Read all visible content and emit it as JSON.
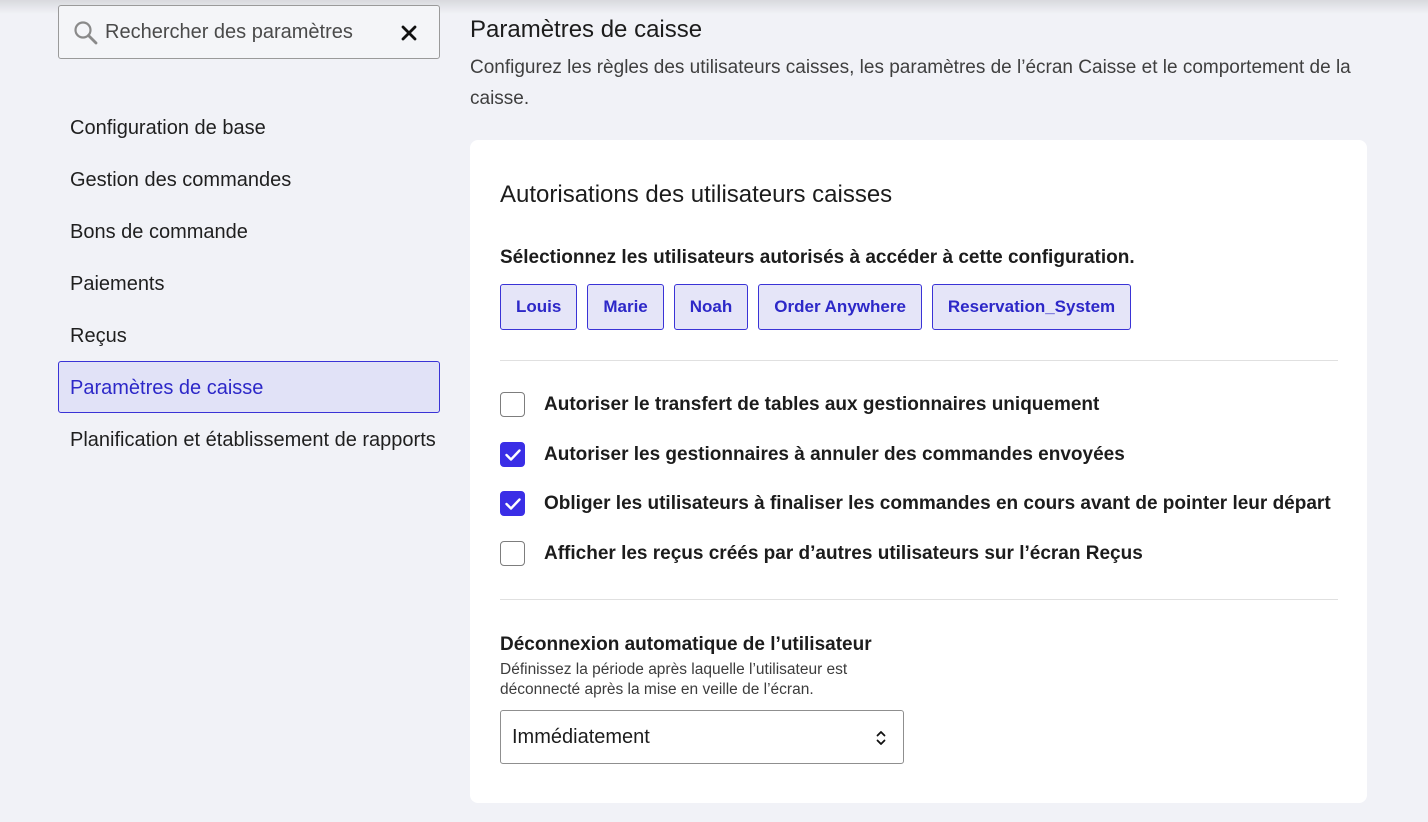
{
  "sidebar": {
    "search": {
      "placeholder": "Rechercher des paramètres",
      "value": ""
    },
    "items": [
      {
        "label": "Configuration de base",
        "active": false
      },
      {
        "label": "Gestion des commandes",
        "active": false
      },
      {
        "label": "Bons de commande",
        "active": false
      },
      {
        "label": "Paiements",
        "active": false
      },
      {
        "label": "Reçus",
        "active": false
      },
      {
        "label": "Paramètres de caisse",
        "active": true
      },
      {
        "label": "Planification et établissement de rapports",
        "active": false
      }
    ]
  },
  "main": {
    "title": "Paramètres de caisse",
    "description": "Configurez les règles des utilisateurs caisses, les paramètres de l’écran Caisse et le comportement de la caisse.",
    "card": {
      "title": "Autorisations des utilisateurs caisses",
      "users_label": "Sélectionnez les utilisateurs autorisés à accéder à cette configuration.",
      "users": [
        "Louis",
        "Marie",
        "Noah",
        "Order Anywhere",
        "Reservation_System"
      ],
      "options": [
        {
          "label": "Autoriser le transfert de tables aux gestionnaires uniquement",
          "checked": false
        },
        {
          "label": "Autoriser les gestionnaires à annuler des commandes envoyées",
          "checked": true
        },
        {
          "label": "Obliger les utilisateurs à finaliser les commandes en cours avant de pointer leur départ",
          "checked": true
        },
        {
          "label": "Afficher les reçus créés par d’autres utilisateurs sur l’écran Reçus",
          "checked": false
        }
      ],
      "logout": {
        "title": "Déconnexion automatique de l’utilisateur",
        "description": "Définissez la période après laquelle l’utilisateur est déconnecté après la mise en veille de l’écran.",
        "selected": "Immédiatement"
      }
    }
  },
  "colors": {
    "accent": "#3a33d6",
    "accent_bg": "#e1e2f7",
    "page_bg": "#f1f2f7",
    "card_bg": "#ffffff"
  }
}
